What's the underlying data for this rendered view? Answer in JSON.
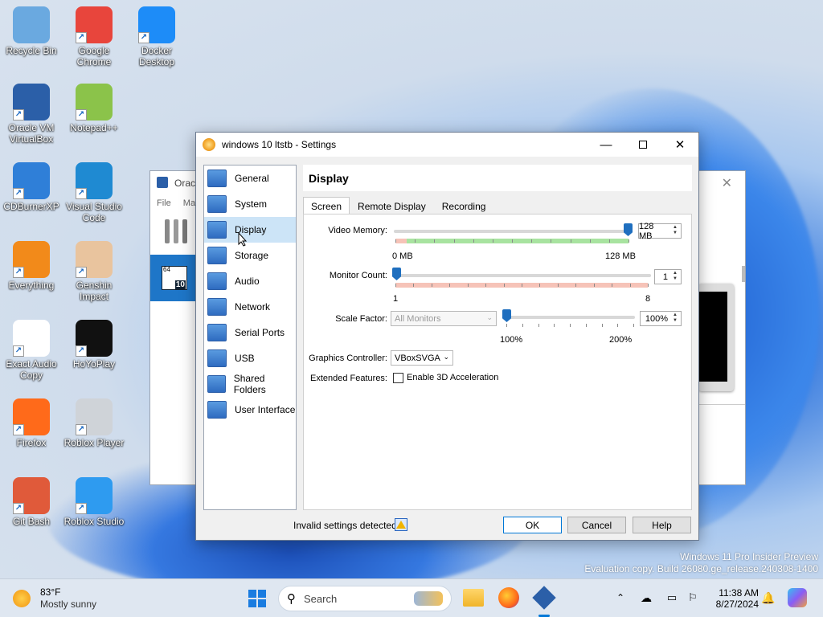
{
  "desktop": {
    "icons": [
      {
        "label": "Recycle Bin",
        "icon": "recycle-bin-icon",
        "color": "#6aa9e0"
      },
      {
        "label": "Google Chrome",
        "icon": "chrome-icon",
        "color": "#e8453c"
      },
      {
        "label": "Docker Desktop",
        "icon": "docker-icon",
        "color": "#1d8cf8"
      },
      {
        "label": "Oracle VM VirtualBox",
        "icon": "virtualbox-icon",
        "color": "#2b5fa8"
      },
      {
        "label": "Notepad++",
        "icon": "notepadpp-icon",
        "color": "#8bc34a"
      },
      {
        "label": "CDBurnerXP",
        "icon": "cdburnerxp-icon",
        "color": "#2f7fd8"
      },
      {
        "label": "Visual Studio Code",
        "icon": "vscode-icon",
        "color": "#1f8ad2"
      },
      {
        "label": "Everything",
        "icon": "everything-icon",
        "color": "#f28a1a"
      },
      {
        "label": "Genshin Impact",
        "icon": "genshin-icon",
        "color": "#e9c49e"
      },
      {
        "label": "Exact Audio Copy",
        "icon": "eac-icon",
        "color": "#ffffff"
      },
      {
        "label": "HoYoPlay",
        "icon": "hoyoplay-icon",
        "color": "#111111"
      },
      {
        "label": "Firefox",
        "icon": "firefox-icon",
        "color": "#ff6a1a"
      },
      {
        "label": "Roblox Player",
        "icon": "roblox-icon",
        "color": "#cfd3d8"
      },
      {
        "label": "Git Bash",
        "icon": "git-bash-icon",
        "color": "#e05a3a"
      },
      {
        "label": "Roblox Studio",
        "icon": "roblox-studio-icon",
        "color": "#2e9bf0"
      }
    ],
    "watermark_line1": "Windows 11 Pro Insider Preview",
    "watermark_line2": "Evaluation copy. Build 26080.ge_release.240308-1400"
  },
  "bg_window": {
    "title": "Orac",
    "menu_file": "File",
    "menu_machine": "Ma",
    "vm_badge": "10",
    "vm_badge_top": "64"
  },
  "dialog": {
    "title": "windows 10 ltstb - Settings",
    "categories": [
      {
        "label": "General",
        "icon": "general-icon"
      },
      {
        "label": "System",
        "icon": "system-chip-icon"
      },
      {
        "label": "Display",
        "icon": "display-monitor-icon"
      },
      {
        "label": "Storage",
        "icon": "storage-disk-icon"
      },
      {
        "label": "Audio",
        "icon": "audio-speaker-icon"
      },
      {
        "label": "Network",
        "icon": "network-icon"
      },
      {
        "label": "Serial Ports",
        "icon": "serial-port-icon"
      },
      {
        "label": "USB",
        "icon": "usb-icon"
      },
      {
        "label": "Shared Folders",
        "icon": "shared-folder-icon"
      },
      {
        "label": "User Interface",
        "icon": "user-interface-icon"
      }
    ],
    "selected_category": "Display",
    "panel_title": "Display",
    "tabs": [
      "Screen",
      "Remote Display",
      "Recording"
    ],
    "selected_tab": "Screen",
    "video_memory": {
      "label": "Video Memory:",
      "value": "128 MB",
      "min_label": "0 MB",
      "max_label": "128 MB",
      "level": 1.0
    },
    "monitor_count": {
      "label": "Monitor Count:",
      "value": "1",
      "min_label": "1",
      "max_label": "8",
      "level": 0.0
    },
    "scale_factor": {
      "label": "Scale Factor:",
      "combo": "All Monitors",
      "value": "100%",
      "min_label": "100%",
      "max_label": "200%",
      "level": 0.0
    },
    "graphics_controller": {
      "label": "Graphics Controller:",
      "value": "VBoxSVGA"
    },
    "extended_features": {
      "label": "Extended Features:",
      "checkbox_label": "Enable 3D Acceleration",
      "checked": false
    },
    "status_text": "Invalid settings detected",
    "ok": "OK",
    "cancel": "Cancel",
    "help": "Help"
  },
  "taskbar": {
    "weather_temp": "83°F",
    "weather_desc": "Mostly sunny",
    "search_placeholder": "Search",
    "time": "11:38 AM",
    "date": "8/27/2024"
  },
  "colors": {
    "accent": "#0078d7",
    "selection": "#cce4f7",
    "slider_thumb": "#1f6fbf",
    "good_zone": "#a8e3a0",
    "bad_zone": "#f6c3b8"
  }
}
